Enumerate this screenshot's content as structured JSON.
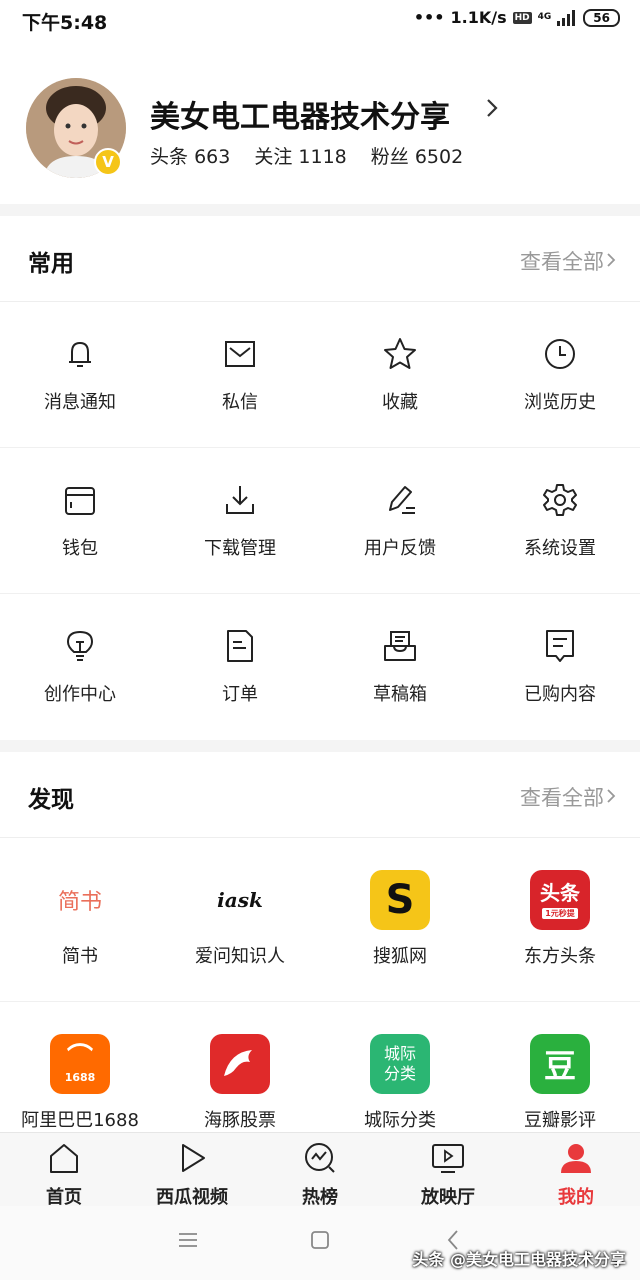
{
  "status_bar": {
    "time": "下午5:48",
    "net_speed": "1.1K/s",
    "hd": "HD",
    "network": "4G",
    "battery": "56"
  },
  "profile": {
    "name": "美女电工电器技术分享",
    "badge": "V",
    "stats": [
      {
        "label": "头条",
        "value": "663"
      },
      {
        "label": "关注",
        "value": "1118"
      },
      {
        "label": "粉丝",
        "value": "6502"
      }
    ]
  },
  "common": {
    "title": "常用",
    "more": "查看全部",
    "items": [
      {
        "label": "消息通知",
        "icon": "bell-icon"
      },
      {
        "label": "私信",
        "icon": "mail-icon"
      },
      {
        "label": "收藏",
        "icon": "star-icon"
      },
      {
        "label": "浏览历史",
        "icon": "clock-icon"
      },
      {
        "label": "钱包",
        "icon": "wallet-icon"
      },
      {
        "label": "下载管理",
        "icon": "download-icon"
      },
      {
        "label": "用户反馈",
        "icon": "pen-icon"
      },
      {
        "label": "系统设置",
        "icon": "gear-icon"
      },
      {
        "label": "创作中心",
        "icon": "lightbulb-icon"
      },
      {
        "label": "订单",
        "icon": "document-icon"
      },
      {
        "label": "草稿箱",
        "icon": "inbox-icon"
      },
      {
        "label": "已购内容",
        "icon": "receipt-icon"
      }
    ]
  },
  "discover": {
    "title": "发现",
    "more": "查看全部",
    "apps": [
      {
        "label": "简书",
        "icon": "jianshu-logo-icon",
        "logo_text": "简书",
        "color": "#ea6f5a"
      },
      {
        "label": "爱问知识人",
        "icon": "iask-logo-icon",
        "logo_text": "iask",
        "color": "#111111"
      },
      {
        "label": "搜狐网",
        "icon": "sohu-logo-icon",
        "logo_text": "S",
        "color": "#f5c518"
      },
      {
        "label": "东方头条",
        "icon": "dftt-logo-icon",
        "logo_text": "头条",
        "logo_sub": "1元秒提",
        "color": "#d8242a"
      },
      {
        "label": "阿里巴巴1688",
        "icon": "alibaba-logo-icon",
        "logo_text": "1688",
        "color": "#ff6a00"
      },
      {
        "label": "海豚股票",
        "icon": "dolphin-logo-icon",
        "logo_text": "",
        "color": "#e02a2a"
      },
      {
        "label": "城际分类",
        "icon": "chengji-logo-icon",
        "logo_text": "城际\n分类",
        "color": "#2bb673"
      },
      {
        "label": "豆瓣影评",
        "icon": "douban-logo-icon",
        "logo_text": "豆",
        "color": "#2ab03e"
      }
    ]
  },
  "tabbar": {
    "items": [
      {
        "label": "首页",
        "icon": "home-icon"
      },
      {
        "label": "西瓜视频",
        "icon": "play-icon"
      },
      {
        "label": "热榜",
        "icon": "trending-icon"
      },
      {
        "label": "放映厅",
        "icon": "tv-icon"
      },
      {
        "label": "我的",
        "icon": "user-icon",
        "active": true
      }
    ],
    "active_color": "#e8393c"
  },
  "watermark": "头条 @美女电工电器技术分享"
}
